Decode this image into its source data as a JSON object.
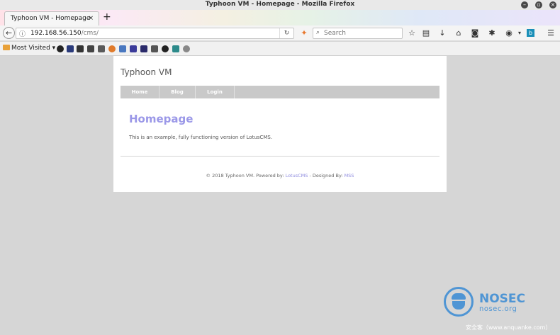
{
  "window": {
    "title": "Typhoon VM - Homepage - Mozilla Firefox"
  },
  "tab": {
    "title": "Typhoon VM - Homepage",
    "close": "×",
    "new_tab": "+"
  },
  "navbar": {
    "url_host": "192.168.56.150",
    "url_path": "/cms/",
    "search_placeholder": "Search"
  },
  "bookmarks": {
    "most_visited": "Most Visited"
  },
  "site": {
    "title": "Typhoon VM",
    "menu": [
      "Home",
      "Blog",
      "Login"
    ],
    "heading": "Homepage",
    "text": "This is an example, fully functioning version of LotusCMS.",
    "footer": {
      "prefix": "© 2018 Typhoon VM. Powered by: ",
      "powered_link": "LotusCMS",
      "middle": " - Designed By: ",
      "designer_link": "MSS"
    }
  },
  "watermark": {
    "brand": "NOSEC",
    "site": "nosec.org",
    "caption": "安全客（www.anquanke.com）"
  },
  "colors": {
    "accent": "#9b98e8",
    "menu": "#c9c9c9",
    "watermark": "#4f95d4"
  }
}
